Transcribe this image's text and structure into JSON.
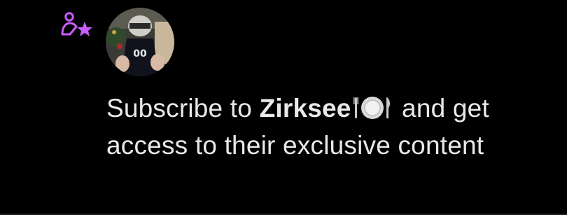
{
  "notification": {
    "type_icon": "person-star-icon",
    "icon_color": "#c95cff",
    "avatar": "user-avatar",
    "message": {
      "prefix": "Subscribe to ",
      "name": "Zirksee",
      "name_emoji": "plate-with-cutlery-emoji",
      "suffix": " and get access to their exclusive content"
    }
  }
}
